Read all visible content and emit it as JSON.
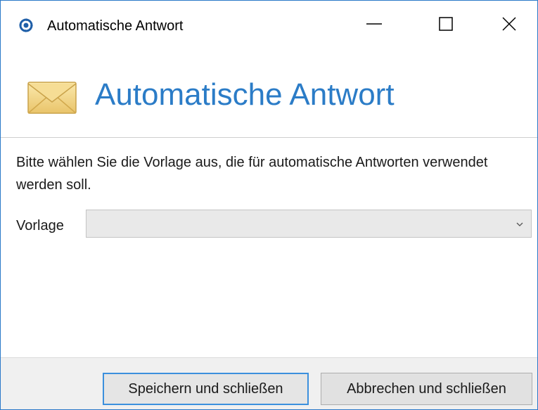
{
  "window": {
    "title": "Automatische Antwort",
    "accent_color": "#2b7cc7"
  },
  "title_buttons": {
    "minimize_icon": "minimize-icon",
    "maximize_icon": "maximize-icon",
    "close_icon": "close-icon"
  },
  "header": {
    "title": "Automatische Antwort",
    "icon": "envelope-icon"
  },
  "body": {
    "description": "Bitte wählen Sie die Vorlage aus, die für automatische Antworten verwendet werden soll.",
    "vorlage_label": "Vorlage",
    "vorlage_value": ""
  },
  "footer": {
    "save_label": "Speichern und schließen",
    "cancel_label": "Abbrechen und schließen"
  }
}
